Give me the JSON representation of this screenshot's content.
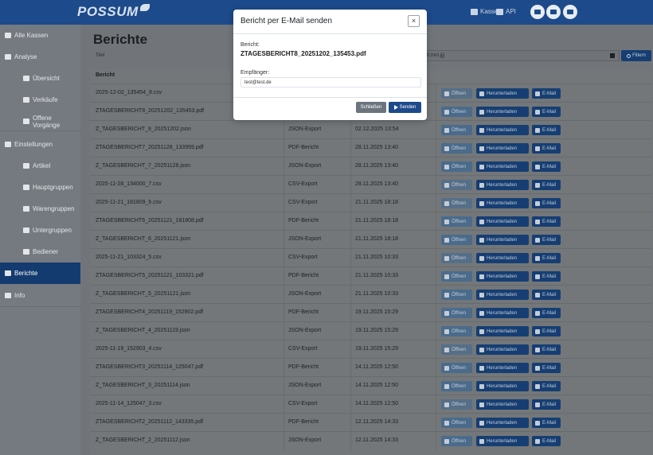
{
  "navbar": {
    "logo": "POSSUM",
    "links": [
      {
        "icon": "cash-register-icon",
        "label": "Kassen"
      },
      {
        "icon": "network-icon",
        "label": "API"
      }
    ],
    "icon_buttons": [
      "drawer-icon",
      "user-settings-icon",
      "logout-icon"
    ]
  },
  "sidebar": {
    "items": [
      {
        "label": "Alle Kassen",
        "icon": "arrow-left-icon",
        "level": "top"
      },
      {
        "label": "Analyse",
        "icon": "chart-icon",
        "level": "top"
      },
      {
        "label": "Übersicht",
        "icon": "palette-icon",
        "level": "sub"
      },
      {
        "label": "Verkäufe",
        "icon": "cart-icon",
        "level": "sub"
      },
      {
        "label": "Offene Vorgänge",
        "icon": "list-icon",
        "level": "sub"
      },
      {
        "label": "Einstellungen",
        "icon": "store-icon",
        "level": "top"
      },
      {
        "label": "Artikel",
        "icon": "box-icon",
        "level": "sub"
      },
      {
        "label": "Hauptgruppen",
        "icon": "sitemap-icon",
        "level": "sub"
      },
      {
        "label": "Warengruppen",
        "icon": "sitemap-icon",
        "level": "sub"
      },
      {
        "label": "Untergruppen",
        "icon": "sitemap-icon",
        "level": "sub"
      },
      {
        "label": "Bediener",
        "icon": "users-icon",
        "level": "sub"
      },
      {
        "label": "Berichte",
        "icon": "folder-icon",
        "level": "top",
        "active": true
      },
      {
        "label": "Info",
        "icon": "info-icon",
        "level": "top"
      }
    ]
  },
  "main": {
    "title": "Berichte",
    "filter": {
      "title_label": "Titel",
      "date_placeholder": "tt.mm.jjjj",
      "button_label": "Filtern"
    },
    "table": {
      "header": "Bericht",
      "button_labels": {
        "open": "Öffnen",
        "download": "Herunterladen",
        "email": "E-Mail"
      },
      "rows": [
        {
          "name": "2025-12-02_135454_8.csv",
          "type": "",
          "date": ""
        },
        {
          "name": "ZTAGESBERICHT8_20251202_135453.pdf",
          "type": "",
          "date": ""
        },
        {
          "name": "Z_TAGESBERICHT_8_20251202.json",
          "type": "JSON-Export",
          "date": "02.12.2025 13:54"
        },
        {
          "name": "ZTAGESBERICHT7_20251128_133959.pdf",
          "type": "PDF-Bericht",
          "date": "28.11.2025 13:40"
        },
        {
          "name": "Z_TAGESBERICHT_7_20251128.json",
          "type": "JSON-Export",
          "date": "28.11.2025 13:40"
        },
        {
          "name": "2025-11-28_134000_7.csv",
          "type": "CSV-Export",
          "date": "28.11.2025 13:40"
        },
        {
          "name": "2025-11-21_181809_6.csv",
          "type": "CSV-Export",
          "date": "21.11.2025 18:18"
        },
        {
          "name": "ZTAGESBERICHT6_20251121_181808.pdf",
          "type": "PDF-Bericht",
          "date": "21.11.2025 18:18"
        },
        {
          "name": "Z_TAGESBERICHT_6_20251121.json",
          "type": "JSON-Export",
          "date": "21.11.2025 18:18"
        },
        {
          "name": "2025-11-21_103324_5.csv",
          "type": "CSV-Export",
          "date": "21.11.2025 10:33"
        },
        {
          "name": "ZTAGESBERICHT5_20251121_103321.pdf",
          "type": "PDF-Bericht",
          "date": "21.11.2025 10:33"
        },
        {
          "name": "Z_TAGESBERICHT_5_20251121.json",
          "type": "JSON-Export",
          "date": "21.11.2025 10:33"
        },
        {
          "name": "ZTAGESBERICHT4_20251119_152902.pdf",
          "type": "PDF-Bericht",
          "date": "19.11.2025 15:29"
        },
        {
          "name": "Z_TAGESBERICHT_4_20251119.json",
          "type": "JSON-Export",
          "date": "19.11.2025 15:29"
        },
        {
          "name": "2025-11-19_152903_4.csv",
          "type": "CSV-Export",
          "date": "19.11.2025 15:29"
        },
        {
          "name": "ZTAGESBERICHT3_20251114_125047.pdf",
          "type": "PDF-Bericht",
          "date": "14.11.2025 12:50"
        },
        {
          "name": "Z_TAGESBERICHT_3_20251114.json",
          "type": "JSON-Export",
          "date": "14.11.2025 12:50"
        },
        {
          "name": "2025-11-14_125047_3.csv",
          "type": "CSV-Export",
          "date": "14.11.2025 12:50"
        },
        {
          "name": "ZTAGESBERICHT2_20251112_143335.pdf",
          "type": "PDF-Bericht",
          "date": "12.11.2025 14:33"
        },
        {
          "name": "Z_TAGESBERICHT_2_20251112.json",
          "type": "JSON-Export",
          "date": "12.11.2025 14:33"
        }
      ]
    }
  },
  "modal": {
    "title": "Bericht per E-Mail senden",
    "close_symbol": "×",
    "report_label": "Bericht:",
    "report_file": "ZTAGESBERICHT8_20251202_135453.pdf",
    "recipient_label": "Empfänger:",
    "recipient_value": "test@test.de",
    "close_button": "Schließen",
    "send_button": "Senden"
  }
}
